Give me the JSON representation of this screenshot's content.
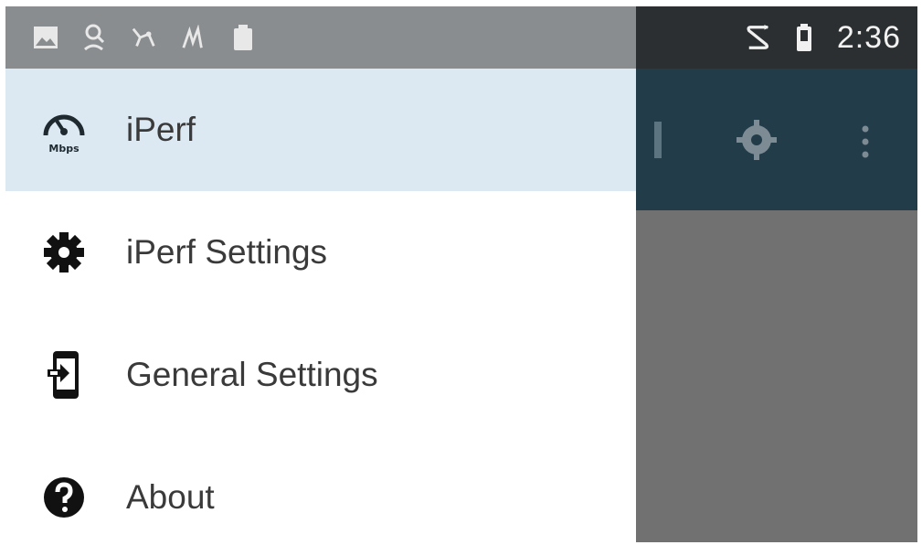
{
  "status_bar": {
    "time": "2:36",
    "notification_icons": [
      "image-icon",
      "search-person-icon",
      "route-icon",
      "signal-path-icon",
      "clipboard-icon"
    ],
    "system_icons": [
      "swipe-icon",
      "battery-icon"
    ]
  },
  "drawer": {
    "items": [
      {
        "label": "iPerf",
        "icon": "speedometer-icon",
        "icon_text": "Mbps",
        "active": true
      },
      {
        "label": "iPerf Settings",
        "icon": "gear-icon",
        "active": false
      },
      {
        "label": "General Settings",
        "icon": "phone-settings-icon",
        "active": false
      },
      {
        "label": "About",
        "icon": "help-icon",
        "active": false
      }
    ]
  },
  "colors": {
    "status_bar_dark": "#2b2f31",
    "status_bar_light": "#8a8d8f",
    "toolbar": "#233c4a",
    "scrim": "#717171",
    "drawer_active": "#dce9f3",
    "drawer_bg": "#ffffff",
    "text": "#3a3a3a"
  }
}
